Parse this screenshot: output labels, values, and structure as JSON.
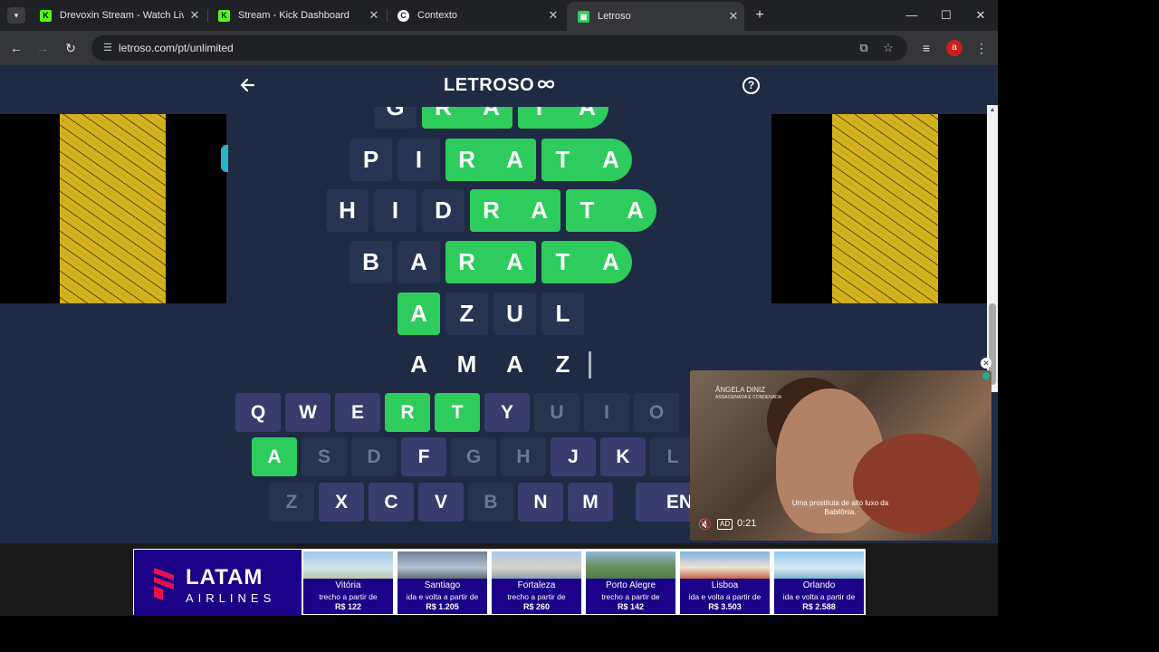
{
  "browser": {
    "tabs": [
      {
        "title": "Drevoxin Stream - Watch Live o",
        "favicon": "kick-icon",
        "active": false
      },
      {
        "title": "Stream - Kick Dashboard",
        "favicon": "kick-icon",
        "active": false
      },
      {
        "title": "Contexto",
        "favicon": "contexto-icon",
        "active": false
      },
      {
        "title": "Letroso",
        "favicon": "letroso-icon",
        "active": true
      }
    ],
    "url": "letroso.com/pt/unlimited",
    "profile_initial": "a"
  },
  "game": {
    "title": "LETROSO",
    "help": "?",
    "rows": [
      [
        "G",
        "R",
        "A",
        "T",
        "A"
      ],
      [
        "P",
        "I",
        "R",
        "A",
        "T",
        "A"
      ],
      [
        "H",
        "I",
        "D",
        "R",
        "A",
        "T",
        "A"
      ],
      [
        "B",
        "A",
        "R",
        "A",
        "T",
        "A"
      ],
      [
        "A",
        "Z",
        "U",
        "L"
      ],
      [
        "A",
        "M",
        "A",
        "Z"
      ]
    ],
    "keyboard": {
      "row1": [
        "Q",
        "W",
        "E",
        "R",
        "T",
        "Y",
        "U",
        "I",
        "O"
      ],
      "row2": [
        "A",
        "S",
        "D",
        "F",
        "G",
        "H",
        "J",
        "K",
        "L"
      ],
      "row3": [
        "Z",
        "X",
        "C",
        "V",
        "B",
        "N",
        "M"
      ],
      "enter": "EN"
    },
    "colors": {
      "green": "#2ecc5c",
      "tile": "#273553",
      "key": "#3a3c6e",
      "background": "#1f2a44"
    }
  },
  "video_ad": {
    "brand_title": "ÂNGELA DINIZ",
    "brand_subtitle": "ASSASSINADA E CONDENADA",
    "caption": "Uma prostituta de alto luxo da Babilônia.",
    "ad_label": "AD",
    "time": "0:21"
  },
  "banner": {
    "brand": "LATAM",
    "brand_sub": "AIRLINES",
    "destinations": [
      {
        "city": "Vitória",
        "desc": "trecho a partir de",
        "price": "R$ 122"
      },
      {
        "city": "Santiago",
        "desc": "ida e volta a partir de",
        "price": "R$ 1.205"
      },
      {
        "city": "Fortaleza",
        "desc": "trecho a partir de",
        "price": "R$ 260"
      },
      {
        "city": "Porto Alegre",
        "desc": "trecho a partir de",
        "price": "R$ 142"
      },
      {
        "city": "Lisboa",
        "desc": "ida e volta a partir de",
        "price": "R$ 3.503"
      },
      {
        "city": "Orlando",
        "desc": "ida e volta a partir de",
        "price": "R$ 2.588"
      }
    ]
  }
}
